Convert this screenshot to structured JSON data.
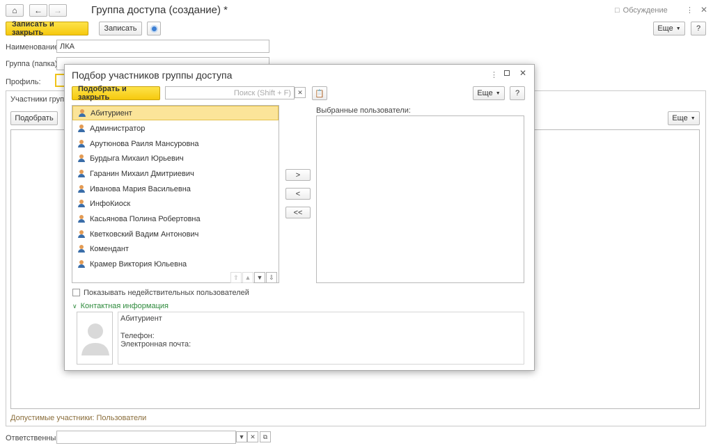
{
  "window": {
    "title": "Группа доступа (создание) *",
    "discussion": "Обсуждение"
  },
  "toolbar": {
    "save_close": "Записать и закрыть",
    "save": "Записать",
    "more": "Еще",
    "help": "?"
  },
  "form": {
    "name_label": "Наименование:",
    "name_value": "ЛКА",
    "group_label": "Группа (папка):",
    "profile_label": "Профиль:",
    "members_tab": "Участники группы",
    "pick_button": "Подобрать",
    "more": "Еще",
    "allowed_members": "Допустимые участники: Пользователи",
    "responsible_label": "Ответственный:"
  },
  "dialog": {
    "title": "Подбор участников группы доступа",
    "pick_close": "Подобрать и закрыть",
    "search_placeholder": "Поиск (Shift + F)",
    "more": "Еще",
    "help": "?",
    "selected_label": "Выбранные пользователи:",
    "move_right": ">",
    "move_left": "<",
    "move_all_left": "<<",
    "show_invalid": "Показывать недействительных пользователей",
    "contact_info": "Контактная информация",
    "users": [
      "Абитуриент",
      "Администратор",
      "Арутюнова Раиля Мансуровна",
      "Бурдыга Михаил Юрьевич",
      "Гаранин Михаил Дмитриевич",
      "Иванова Мария Васильевна",
      "ИнфоКиоск",
      "Касьянова Полина Робертовна",
      "Кветковский Вадим Антонович",
      "Комендант",
      "Крамер Виктория Юльевна"
    ],
    "info": {
      "name": "Абитуриент",
      "phone": "Телефон:",
      "email": "Электронная почта:"
    }
  },
  "colors": {
    "accent_yellow": "#f6c90e",
    "green_text": "#2e8a3c",
    "selection": "#fbe499"
  }
}
